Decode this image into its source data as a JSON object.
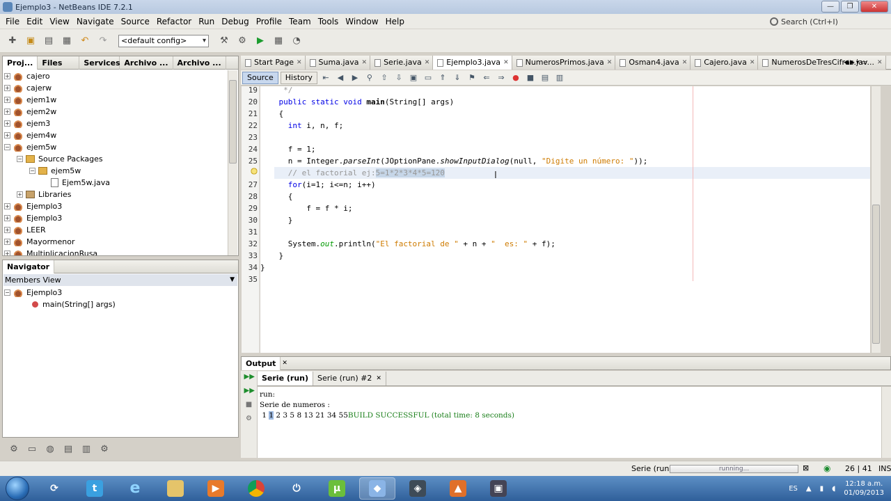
{
  "window": {
    "title": "Ejemplo3 - NetBeans IDE 7.2.1"
  },
  "menu": [
    "File",
    "Edit",
    "View",
    "Navigate",
    "Source",
    "Refactor",
    "Run",
    "Debug",
    "Profile",
    "Team",
    "Tools",
    "Window",
    "Help"
  ],
  "search": {
    "placeholder": "Search (Ctrl+I)"
  },
  "toolbar": {
    "config": "<default config>"
  },
  "projects_panel": {
    "tabs": [
      "Proj...",
      "Files",
      "Services",
      "Archivo ...",
      "Archivo ..."
    ],
    "tree": [
      {
        "label": "cajero",
        "indent": 0,
        "type": "project",
        "exp": "+"
      },
      {
        "label": "cajerw",
        "indent": 0,
        "type": "project",
        "exp": "+"
      },
      {
        "label": "ejem1w",
        "indent": 0,
        "type": "project",
        "exp": "+"
      },
      {
        "label": "ejem2w",
        "indent": 0,
        "type": "project",
        "exp": "+"
      },
      {
        "label": "ejem3",
        "indent": 0,
        "type": "project",
        "exp": "+"
      },
      {
        "label": "ejem4w",
        "indent": 0,
        "type": "project",
        "exp": "+"
      },
      {
        "label": "ejem5w",
        "indent": 0,
        "type": "project",
        "exp": "-"
      },
      {
        "label": "Source Packages",
        "indent": 1,
        "type": "package",
        "exp": "-"
      },
      {
        "label": "ejem5w",
        "indent": 2,
        "type": "package",
        "exp": "-"
      },
      {
        "label": "Ejem5w.java",
        "indent": 3,
        "type": "file",
        "exp": ""
      },
      {
        "label": "Libraries",
        "indent": 1,
        "type": "library",
        "exp": "+"
      },
      {
        "label": "Ejemplo3",
        "indent": 0,
        "type": "project",
        "exp": "+"
      },
      {
        "label": "Ejemplo3",
        "indent": 0,
        "type": "project",
        "exp": "+"
      },
      {
        "label": "LEER",
        "indent": 0,
        "type": "project",
        "exp": "+"
      },
      {
        "label": "Mayormenor",
        "indent": 0,
        "type": "project",
        "exp": "+"
      },
      {
        "label": "MultiplicacionRusa",
        "indent": 0,
        "type": "project",
        "exp": "+"
      }
    ]
  },
  "navigator": {
    "title": "Navigator",
    "view": "Members View",
    "class_name": "Ejemplo3",
    "member": "main(String[] args)"
  },
  "editor": {
    "tabs": [
      "Start Page",
      "Suma.java",
      "Serie.java",
      "Ejemplo3.java",
      "NumerosPrimos.java",
      "Osman4.java",
      "Cajero.java",
      "NumerosDeTresCifras.jav..."
    ],
    "active_tab": 3,
    "mode_source": "Source",
    "mode_history": "History",
    "lines": [
      {
        "n": "19",
        "code": "     */"
      },
      {
        "n": "20",
        "code": "    public static void main(String[] args)"
      },
      {
        "n": "21",
        "code": "    {"
      },
      {
        "n": "22",
        "code": "      int i, n, f;"
      },
      {
        "n": "23",
        "code": ""
      },
      {
        "n": "24",
        "code": "      f = 1;"
      },
      {
        "n": "25",
        "code": "      n = Integer.parseInt(JOptionPane.showInputDialog(null, \"Digite un número: \"));"
      },
      {
        "n": "",
        "code": "      // el factorial ej:5=1*2*3*4*5=120"
      },
      {
        "n": "27",
        "code": "      for(i=1; i<=n; i++)"
      },
      {
        "n": "28",
        "code": "      {"
      },
      {
        "n": "29",
        "code": "          f = f * i;"
      },
      {
        "n": "30",
        "code": "      }"
      },
      {
        "n": "31",
        "code": ""
      },
      {
        "n": "32",
        "code": "      System.out.println(\"El factorial de \" + n + \"  es: \" + f);"
      },
      {
        "n": "33",
        "code": "    }"
      },
      {
        "n": "34",
        "code": "}"
      },
      {
        "n": "35",
        "code": ""
      }
    ]
  },
  "output": {
    "title": "Output",
    "tabs": [
      "Serie (run)",
      "Serie (run) #2"
    ],
    "line1": "run:",
    "line2": "Serie de numeros :",
    "line3_a": " 1 ",
    "line3_caret": "1",
    "line3_b": " 2 3 5 8 13 21 34 55",
    "line3_build": "BUILD SUCCESSFUL (total time: 8 seconds)"
  },
  "status": {
    "task": "Serie (run)",
    "progress_text": "running...",
    "position": "26 | 41",
    "mode": "INS"
  },
  "taskbar": {
    "lang": "ES",
    "time": "12:18 a.m.",
    "date": "01/09/2013"
  }
}
